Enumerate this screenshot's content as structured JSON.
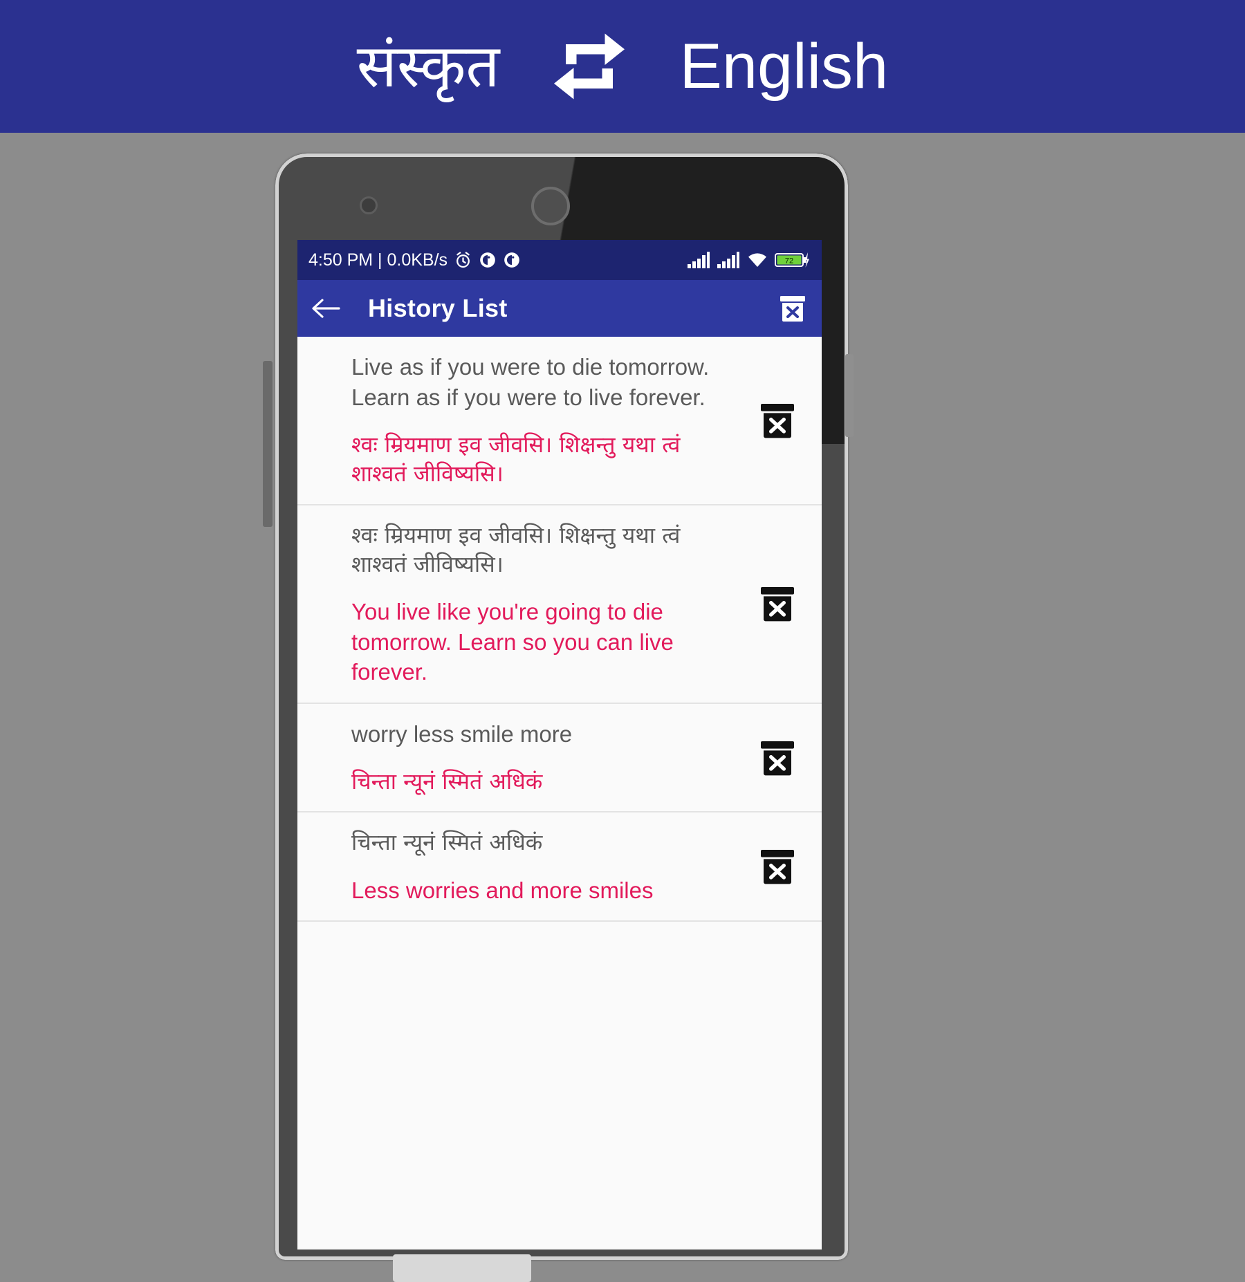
{
  "banner": {
    "source_language": "संस्कृत",
    "target_language": "English",
    "swap_icon": "swap-arrows-icon",
    "background_color": "#2b3190",
    "text_color": "#ffffff"
  },
  "device": {
    "camera_icon": "front-camera-icon",
    "speaker_icon": "earpiece-speaker-icon",
    "power_button": "power-button",
    "volume_button": "volume-button"
  },
  "status_bar": {
    "clock_and_net": "4:50 PM | 0.0KB/s",
    "alarm_icon": "alarm-clock-icon",
    "notification_icon_1": "notification-dot-icon",
    "notification_icon_2": "notification-dot-icon",
    "signal_icon_1": "signal-bars-icon",
    "signal_icon_2": "signal-bars-icon",
    "wifi_icon": "wifi-icon",
    "battery_level": "72",
    "battery_icon": "battery-charging-icon",
    "charging_icon": "lightning-bolt-icon",
    "background_color": "#1d2470"
  },
  "toolbar": {
    "back_icon": "back-arrow-icon",
    "title": "History List",
    "clear_all_icon": "delete-all-icon",
    "background_color": "#2f39a0"
  },
  "colors": {
    "accent_red": "#e21a5b",
    "source_text": "#5a5a5a",
    "screen_bg": "#fafafa",
    "page_bg": "#8c8c8c"
  },
  "history": {
    "items": [
      {
        "source_text": "Live as if you were to die tomorrow. Learn as if you were to live forever.",
        "translated_text": "श्वः म्रियमाण इव जीवसि। शिक्षन्तु यथा त्वं शाश्वतं जीविष्यसि।",
        "source_is_devanagari": false,
        "translated_is_devanagari": true,
        "delete_icon": "delete-item-icon"
      },
      {
        "source_text": "श्वः म्रियमाण इव जीवसि। शिक्षन्तु यथा त्वं शाश्वतं जीविष्यसि।",
        "translated_text": "You live like you're going to die tomorrow. Learn so you can live forever.",
        "source_is_devanagari": true,
        "translated_is_devanagari": false,
        "delete_icon": "delete-item-icon"
      },
      {
        "source_text": "worry less smile more",
        "translated_text": "चिन्ता न्यूनं स्मितं अधिकं",
        "source_is_devanagari": false,
        "translated_is_devanagari": true,
        "delete_icon": "delete-item-icon"
      },
      {
        "source_text": "चिन्ता न्यूनं स्मितं अधिकं",
        "translated_text": "Less worries and more smiles",
        "source_is_devanagari": true,
        "translated_is_devanagari": false,
        "delete_icon": "delete-item-icon"
      }
    ]
  }
}
